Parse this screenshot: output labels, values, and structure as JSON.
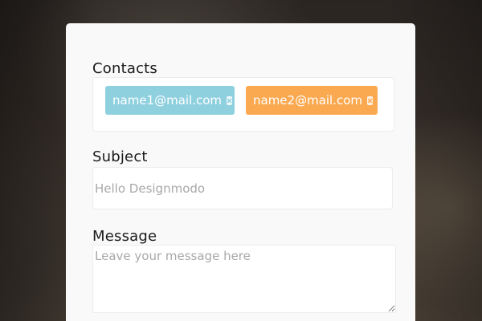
{
  "form": {
    "contacts": {
      "label": "Contacts",
      "tags": [
        {
          "text": "name1@mail.com",
          "color": "#8fd0df",
          "remove_icon": "close-icon"
        },
        {
          "text": "name2@mail.com",
          "color": "#fba950",
          "remove_icon": "close-icon"
        }
      ]
    },
    "subject": {
      "label": "Subject",
      "placeholder": "Hello Designmodo"
    },
    "message": {
      "label": "Message",
      "placeholder": "Leave your message here"
    }
  }
}
